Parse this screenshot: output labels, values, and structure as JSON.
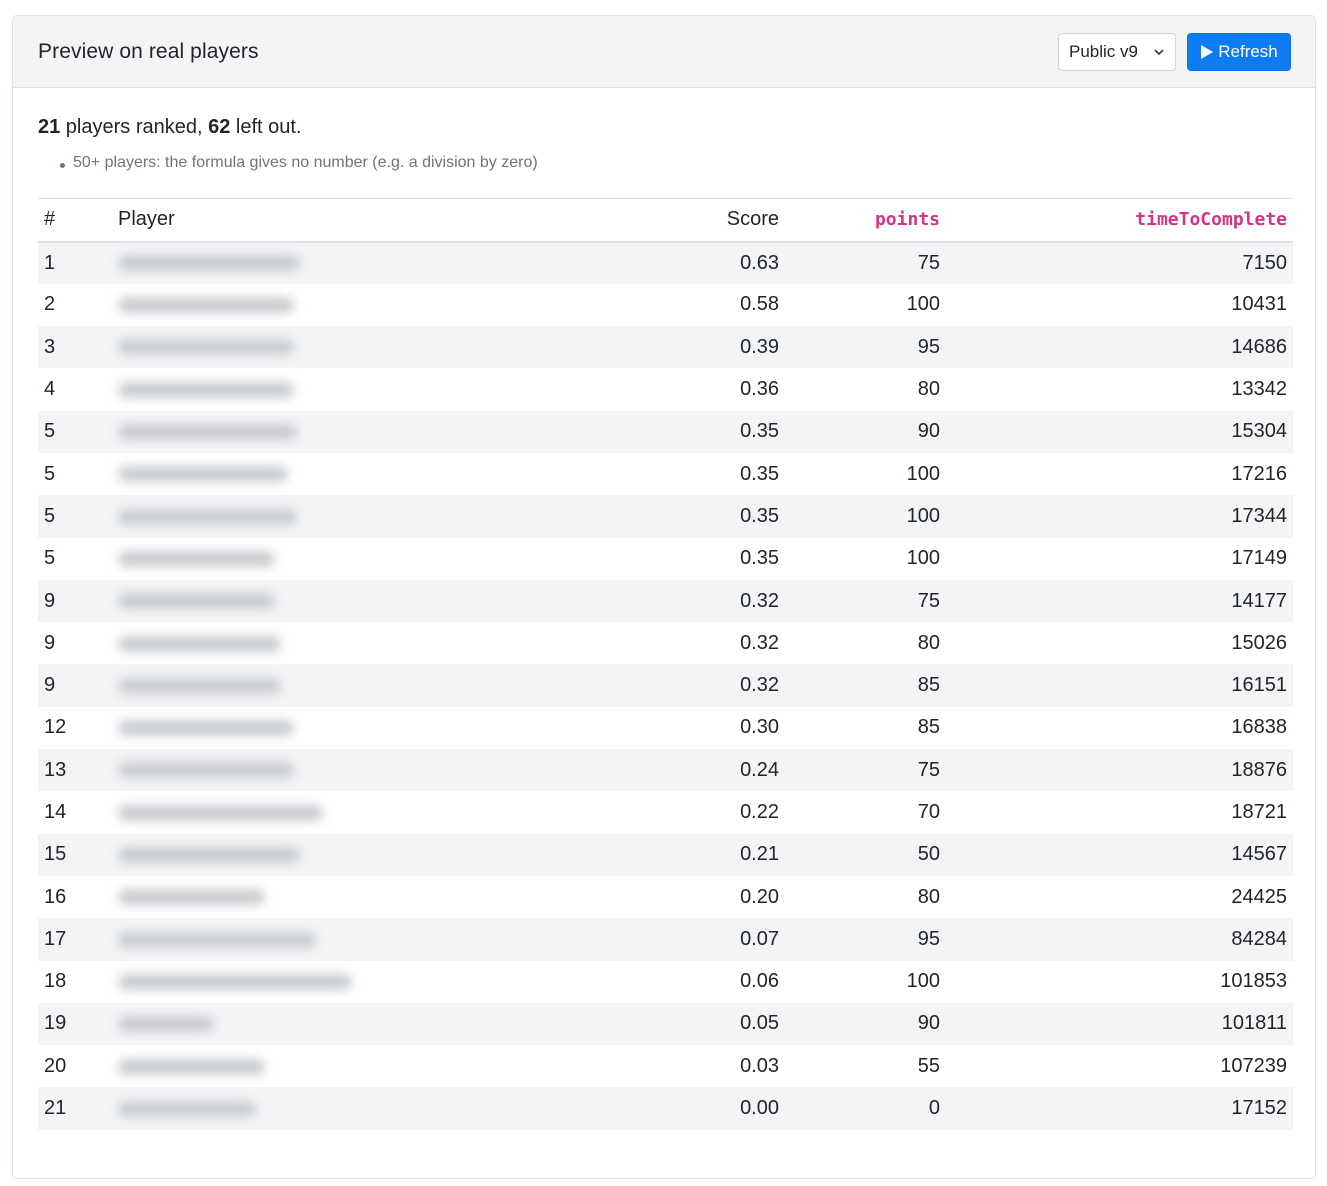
{
  "header": {
    "title": "Preview on real players",
    "version_select": {
      "value": "Public v9",
      "icon": "chevron-down-icon"
    },
    "refresh_button": {
      "label": "Refresh",
      "icon": "play-icon"
    }
  },
  "summary": {
    "ranked_count": "21",
    "ranked_text": " players ranked, ",
    "left_out_count": "62",
    "left_out_text": " left out."
  },
  "notes": [
    "50+ players: the formula gives no number (e.g. a division by zero)"
  ],
  "table": {
    "columns": {
      "rank": "#",
      "player": "Player",
      "score": "Score",
      "points": "points",
      "time": "timeToComplete"
    },
    "rows": [
      {
        "rank": "1",
        "score": "0.63",
        "points": "75",
        "time": "7150",
        "name_blur": 0.57
      },
      {
        "rank": "2",
        "score": "0.58",
        "points": "100",
        "time": "10431",
        "name_blur": 0.55
      },
      {
        "rank": "3",
        "score": "0.39",
        "points": "95",
        "time": "14686",
        "name_blur": 0.55
      },
      {
        "rank": "4",
        "score": "0.36",
        "points": "80",
        "time": "13342",
        "name_blur": 0.55
      },
      {
        "rank": "5",
        "score": "0.35",
        "points": "90",
        "time": "15304",
        "name_blur": 0.56
      },
      {
        "rank": "5",
        "score": "0.35",
        "points": "100",
        "time": "17216",
        "name_blur": 0.53
      },
      {
        "rank": "5",
        "score": "0.35",
        "points": "100",
        "time": "17344",
        "name_blur": 0.56
      },
      {
        "rank": "5",
        "score": "0.35",
        "points": "100",
        "time": "17149",
        "name_blur": 0.49
      },
      {
        "rank": "9",
        "score": "0.32",
        "points": "75",
        "time": "14177",
        "name_blur": 0.49
      },
      {
        "rank": "9",
        "score": "0.32",
        "points": "80",
        "time": "15026",
        "name_blur": 0.51
      },
      {
        "rank": "9",
        "score": "0.32",
        "points": "85",
        "time": "16151",
        "name_blur": 0.51
      },
      {
        "rank": "12",
        "score": "0.30",
        "points": "85",
        "time": "16838",
        "name_blur": 0.55
      },
      {
        "rank": "13",
        "score": "0.24",
        "points": "75",
        "time": "18876",
        "name_blur": 0.55
      },
      {
        "rank": "14",
        "score": "0.22",
        "points": "70",
        "time": "18721",
        "name_blur": 0.64
      },
      {
        "rank": "15",
        "score": "0.21",
        "points": "50",
        "time": "14567",
        "name_blur": 0.57
      },
      {
        "rank": "16",
        "score": "0.20",
        "points": "80",
        "time": "24425",
        "name_blur": 0.46
      },
      {
        "rank": "17",
        "score": "0.07",
        "points": "95",
        "time": "84284",
        "name_blur": 0.62
      },
      {
        "rank": "18",
        "score": "0.06",
        "points": "100",
        "time": "101853",
        "name_blur": 0.73
      },
      {
        "rank": "19",
        "score": "0.05",
        "points": "90",
        "time": "101811",
        "name_blur": 0.3
      },
      {
        "rank": "20",
        "score": "0.03",
        "points": "55",
        "time": "107239",
        "name_blur": 0.46
      },
      {
        "rank": "21",
        "score": "0.00",
        "points": "0",
        "time": "17152",
        "name_blur": 0.43
      }
    ]
  }
}
